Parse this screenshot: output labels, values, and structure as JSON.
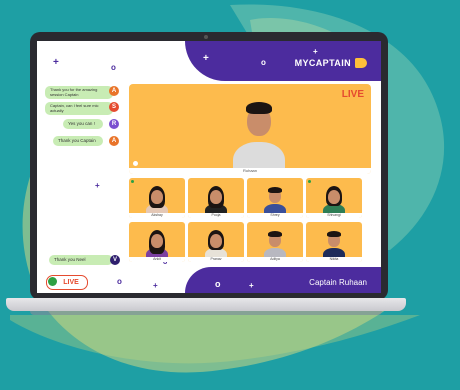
{
  "logo": {
    "text": "MYCAPTAIN"
  },
  "main_video": {
    "live_label": "LIVE",
    "caption": "Ruhaan"
  },
  "participants": [
    {
      "name": "Akshay"
    },
    {
      "name": "Pooja"
    },
    {
      "name": "Shrey"
    },
    {
      "name": "Shivangi"
    },
    {
      "name": "Ankit"
    },
    {
      "name": "Pranav"
    },
    {
      "name": "Aditya"
    },
    {
      "name": "Nikita"
    }
  ],
  "chat": {
    "messages": [
      {
        "initial": "A",
        "color": "#e9742a",
        "text": "Thank you for the amazing session Captain"
      },
      {
        "initial": "S",
        "color": "#e54b2f",
        "text": "Captain, can I feel sure mic actually"
      },
      {
        "initial": "R",
        "color": "#7a4fd0",
        "text": "Yes you can !"
      },
      {
        "initial": "A",
        "color": "#e9742a",
        "text": "Thank you Captain"
      }
    ],
    "last_message": {
      "initial": "V",
      "color": "#2f1f6e",
      "text": "Thank you Neel"
    },
    "live_badge": "LIVE"
  },
  "footer": {
    "captain_name": "Captain Ruhaan"
  },
  "colors": {
    "purple": "#4c2c9e",
    "orange": "#fdbb4d",
    "teal": "#1e9fa4",
    "chat_bubble": "#c8ecb4"
  }
}
